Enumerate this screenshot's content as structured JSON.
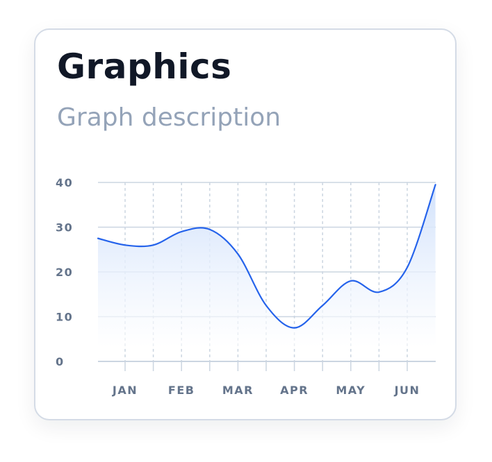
{
  "card": {
    "title": "Graphics",
    "subtitle": "Graph description"
  },
  "chart_data": {
    "type": "area",
    "title": "Graphics",
    "subtitle": "Graph description",
    "categories": [
      "JAN",
      "FEB",
      "MAR",
      "APR",
      "MAY",
      "JUN"
    ],
    "y_ticks": [
      0,
      10,
      20,
      30,
      40
    ],
    "ylim": [
      0,
      40
    ],
    "x_positions": [
      -0.5,
      0,
      0.5,
      1,
      1.5,
      2,
      2.5,
      3,
      3.5,
      4,
      4.5,
      5,
      5.5
    ],
    "series": [
      {
        "values": [
          27.5,
          26,
          26,
          29,
          29.5,
          24,
          12.5,
          7.5,
          12.5,
          18,
          15.5,
          21,
          39.5
        ],
        "color": "#2563eb",
        "fill_top": "#cfe0fb"
      }
    ],
    "grid": {
      "horizontal": true,
      "vertical_dashed": true
    },
    "colors": {
      "line": "#2563eb",
      "grid": "#cbd5e1",
      "tick_text": "#64748b"
    }
  }
}
